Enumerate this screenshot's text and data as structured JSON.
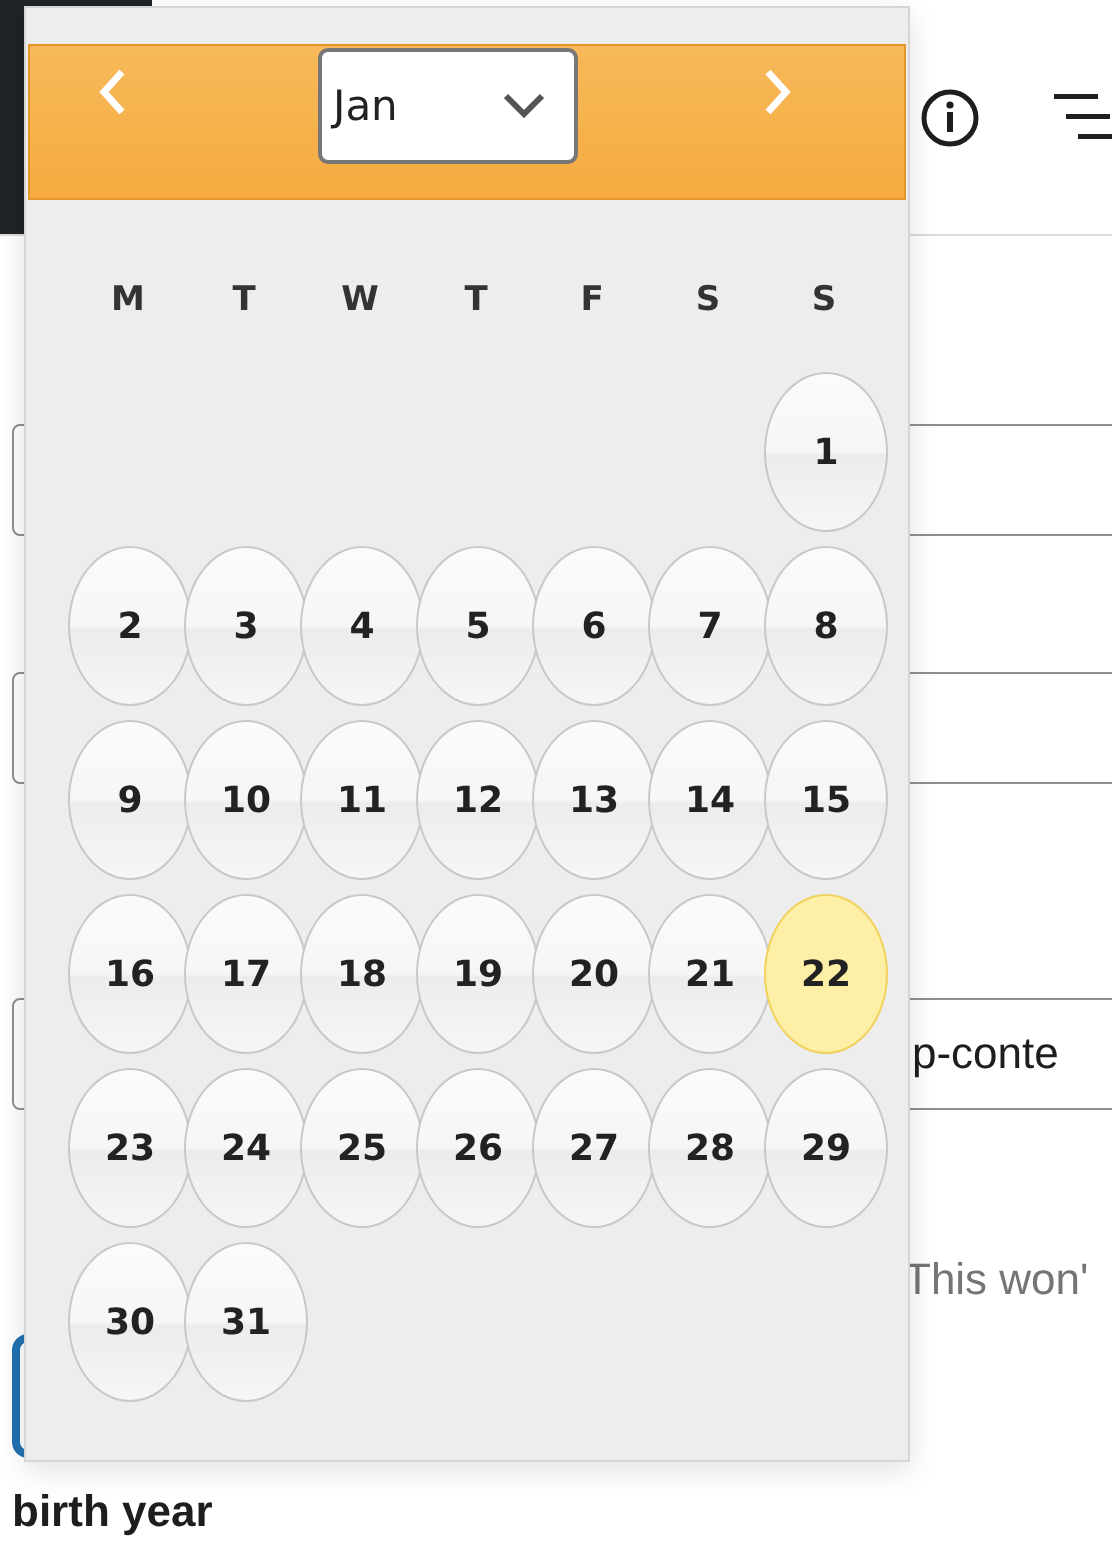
{
  "background": {
    "fields": [
      {
        "kind": "empty"
      },
      {
        "kind": "empty"
      },
      {
        "kind": "text",
        "value": "p-conte"
      }
    ],
    "hint": "This won'",
    "focused_field": {
      "focused": true
    },
    "next_label": "birth year"
  },
  "calendar": {
    "month": "Jan",
    "weekdays": [
      "M",
      "T",
      "W",
      "T",
      "F",
      "S",
      "S"
    ],
    "weeks": [
      [
        {
          "label": "1",
          "selected": false
        }
      ],
      [
        {
          "label": "2",
          "selected": false
        },
        {
          "label": "3",
          "selected": false
        },
        {
          "label": "4",
          "selected": false
        },
        {
          "label": "5",
          "selected": false
        },
        {
          "label": "6",
          "selected": false
        },
        {
          "label": "7",
          "selected": false
        },
        {
          "label": "8",
          "selected": false
        }
      ],
      [
        {
          "label": "9",
          "selected": false
        },
        {
          "label": "10",
          "selected": false
        },
        {
          "label": "11",
          "selected": false
        },
        {
          "label": "12",
          "selected": false
        },
        {
          "label": "13",
          "selected": false
        },
        {
          "label": "14",
          "selected": false
        },
        {
          "label": "15",
          "selected": false
        }
      ],
      [
        {
          "label": "16",
          "selected": false
        },
        {
          "label": "17",
          "selected": false
        },
        {
          "label": "18",
          "selected": false
        },
        {
          "label": "19",
          "selected": false
        },
        {
          "label": "20",
          "selected": false
        },
        {
          "label": "21",
          "selected": false
        },
        {
          "label": "22",
          "selected": true
        }
      ],
      [
        {
          "label": "23",
          "selected": false
        },
        {
          "label": "24",
          "selected": false
        },
        {
          "label": "25",
          "selected": false
        },
        {
          "label": "26",
          "selected": false
        },
        {
          "label": "27",
          "selected": false
        },
        {
          "label": "28",
          "selected": false
        },
        {
          "label": "29",
          "selected": false
        }
      ],
      [
        {
          "label": "30",
          "selected": false
        },
        {
          "label": "31",
          "selected": false
        }
      ]
    ]
  }
}
